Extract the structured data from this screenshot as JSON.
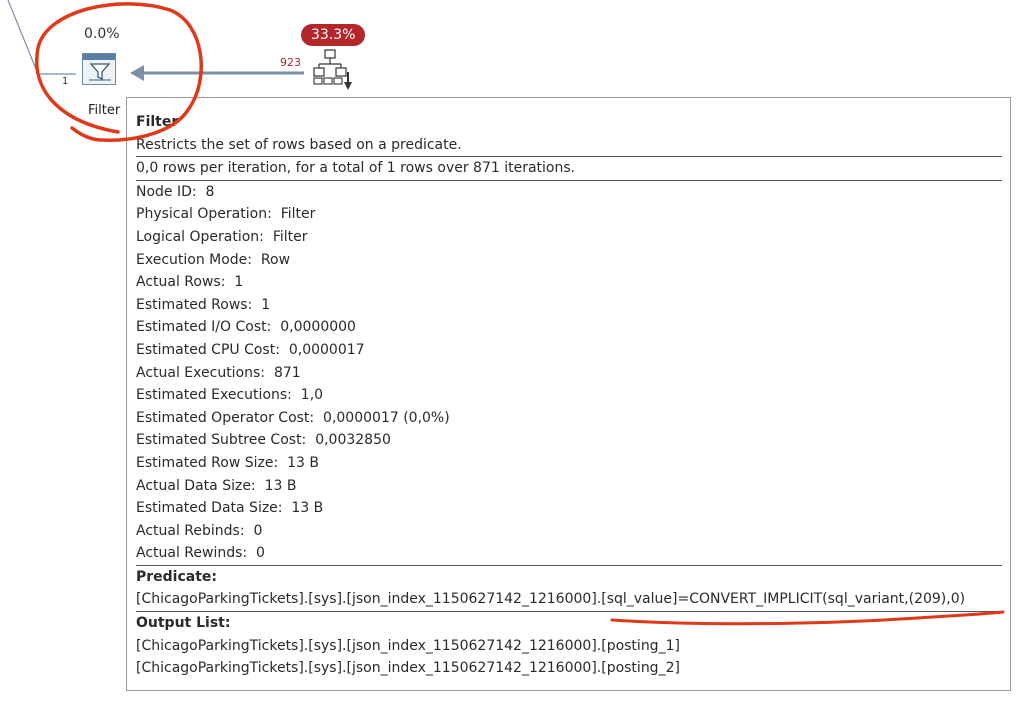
{
  "plan": {
    "filter_cost_pct": "0.0%",
    "upstream_cost_badge": "33.3%",
    "arrow_rows": "923",
    "left_row_count": "1",
    "filter_node_label": "Filter"
  },
  "tooltip": {
    "title": "Filter",
    "description": "Restricts the set of rows based on a predicate.",
    "summary": "0,0 rows per iteration, for a total of 1 rows over 871 iterations.",
    "properties": [
      {
        "label": "Node ID:",
        "value": "8"
      },
      {
        "label": "Physical Operation:",
        "value": "Filter"
      },
      {
        "label": "Logical Operation:",
        "value": "Filter"
      },
      {
        "label": "Execution Mode:",
        "value": "Row"
      },
      {
        "label": "Actual Rows:",
        "value": "1"
      },
      {
        "label": "Estimated Rows:",
        "value": "1"
      },
      {
        "label": "Estimated I/O Cost:",
        "value": "0,0000000"
      },
      {
        "label": "Estimated CPU Cost:",
        "value": "0,0000017"
      },
      {
        "label": "Actual Executions:",
        "value": "871"
      },
      {
        "label": "Estimated Executions:",
        "value": "1,0"
      },
      {
        "label": "Estimated Operator Cost:",
        "value": "0,0000017 (0,0%)"
      },
      {
        "label": "Estimated Subtree Cost:",
        "value": "0,0032850"
      },
      {
        "label": "Estimated Row Size:",
        "value": "13 B"
      },
      {
        "label": "Actual Data Size:",
        "value": "13 B"
      },
      {
        "label": "Estimated Data Size:",
        "value": "13 B"
      },
      {
        "label": "Actual Rebinds:",
        "value": "0"
      },
      {
        "label": "Actual Rewinds:",
        "value": "0"
      }
    ],
    "predicate_heading": "Predicate:",
    "predicate": "[ChicagoParkingTickets].[sys].[json_index_1150627142_1216000].[sql_value]=CONVERT_IMPLICIT(sql_variant,(209),0)",
    "output_heading": "Output List:",
    "output_list": [
      "[ChicagoParkingTickets].[sys].[json_index_1150627142_1216000].[posting_1]",
      "[ChicagoParkingTickets].[sys].[json_index_1150627142_1216000].[posting_2]"
    ]
  },
  "icons": {
    "filter": "filter-funnel-icon",
    "index_scan": "index-scan-tree-icon"
  },
  "colors": {
    "badge": "#b3262a",
    "annotation": "#e0391a",
    "arrow": "#7b8fa6"
  }
}
